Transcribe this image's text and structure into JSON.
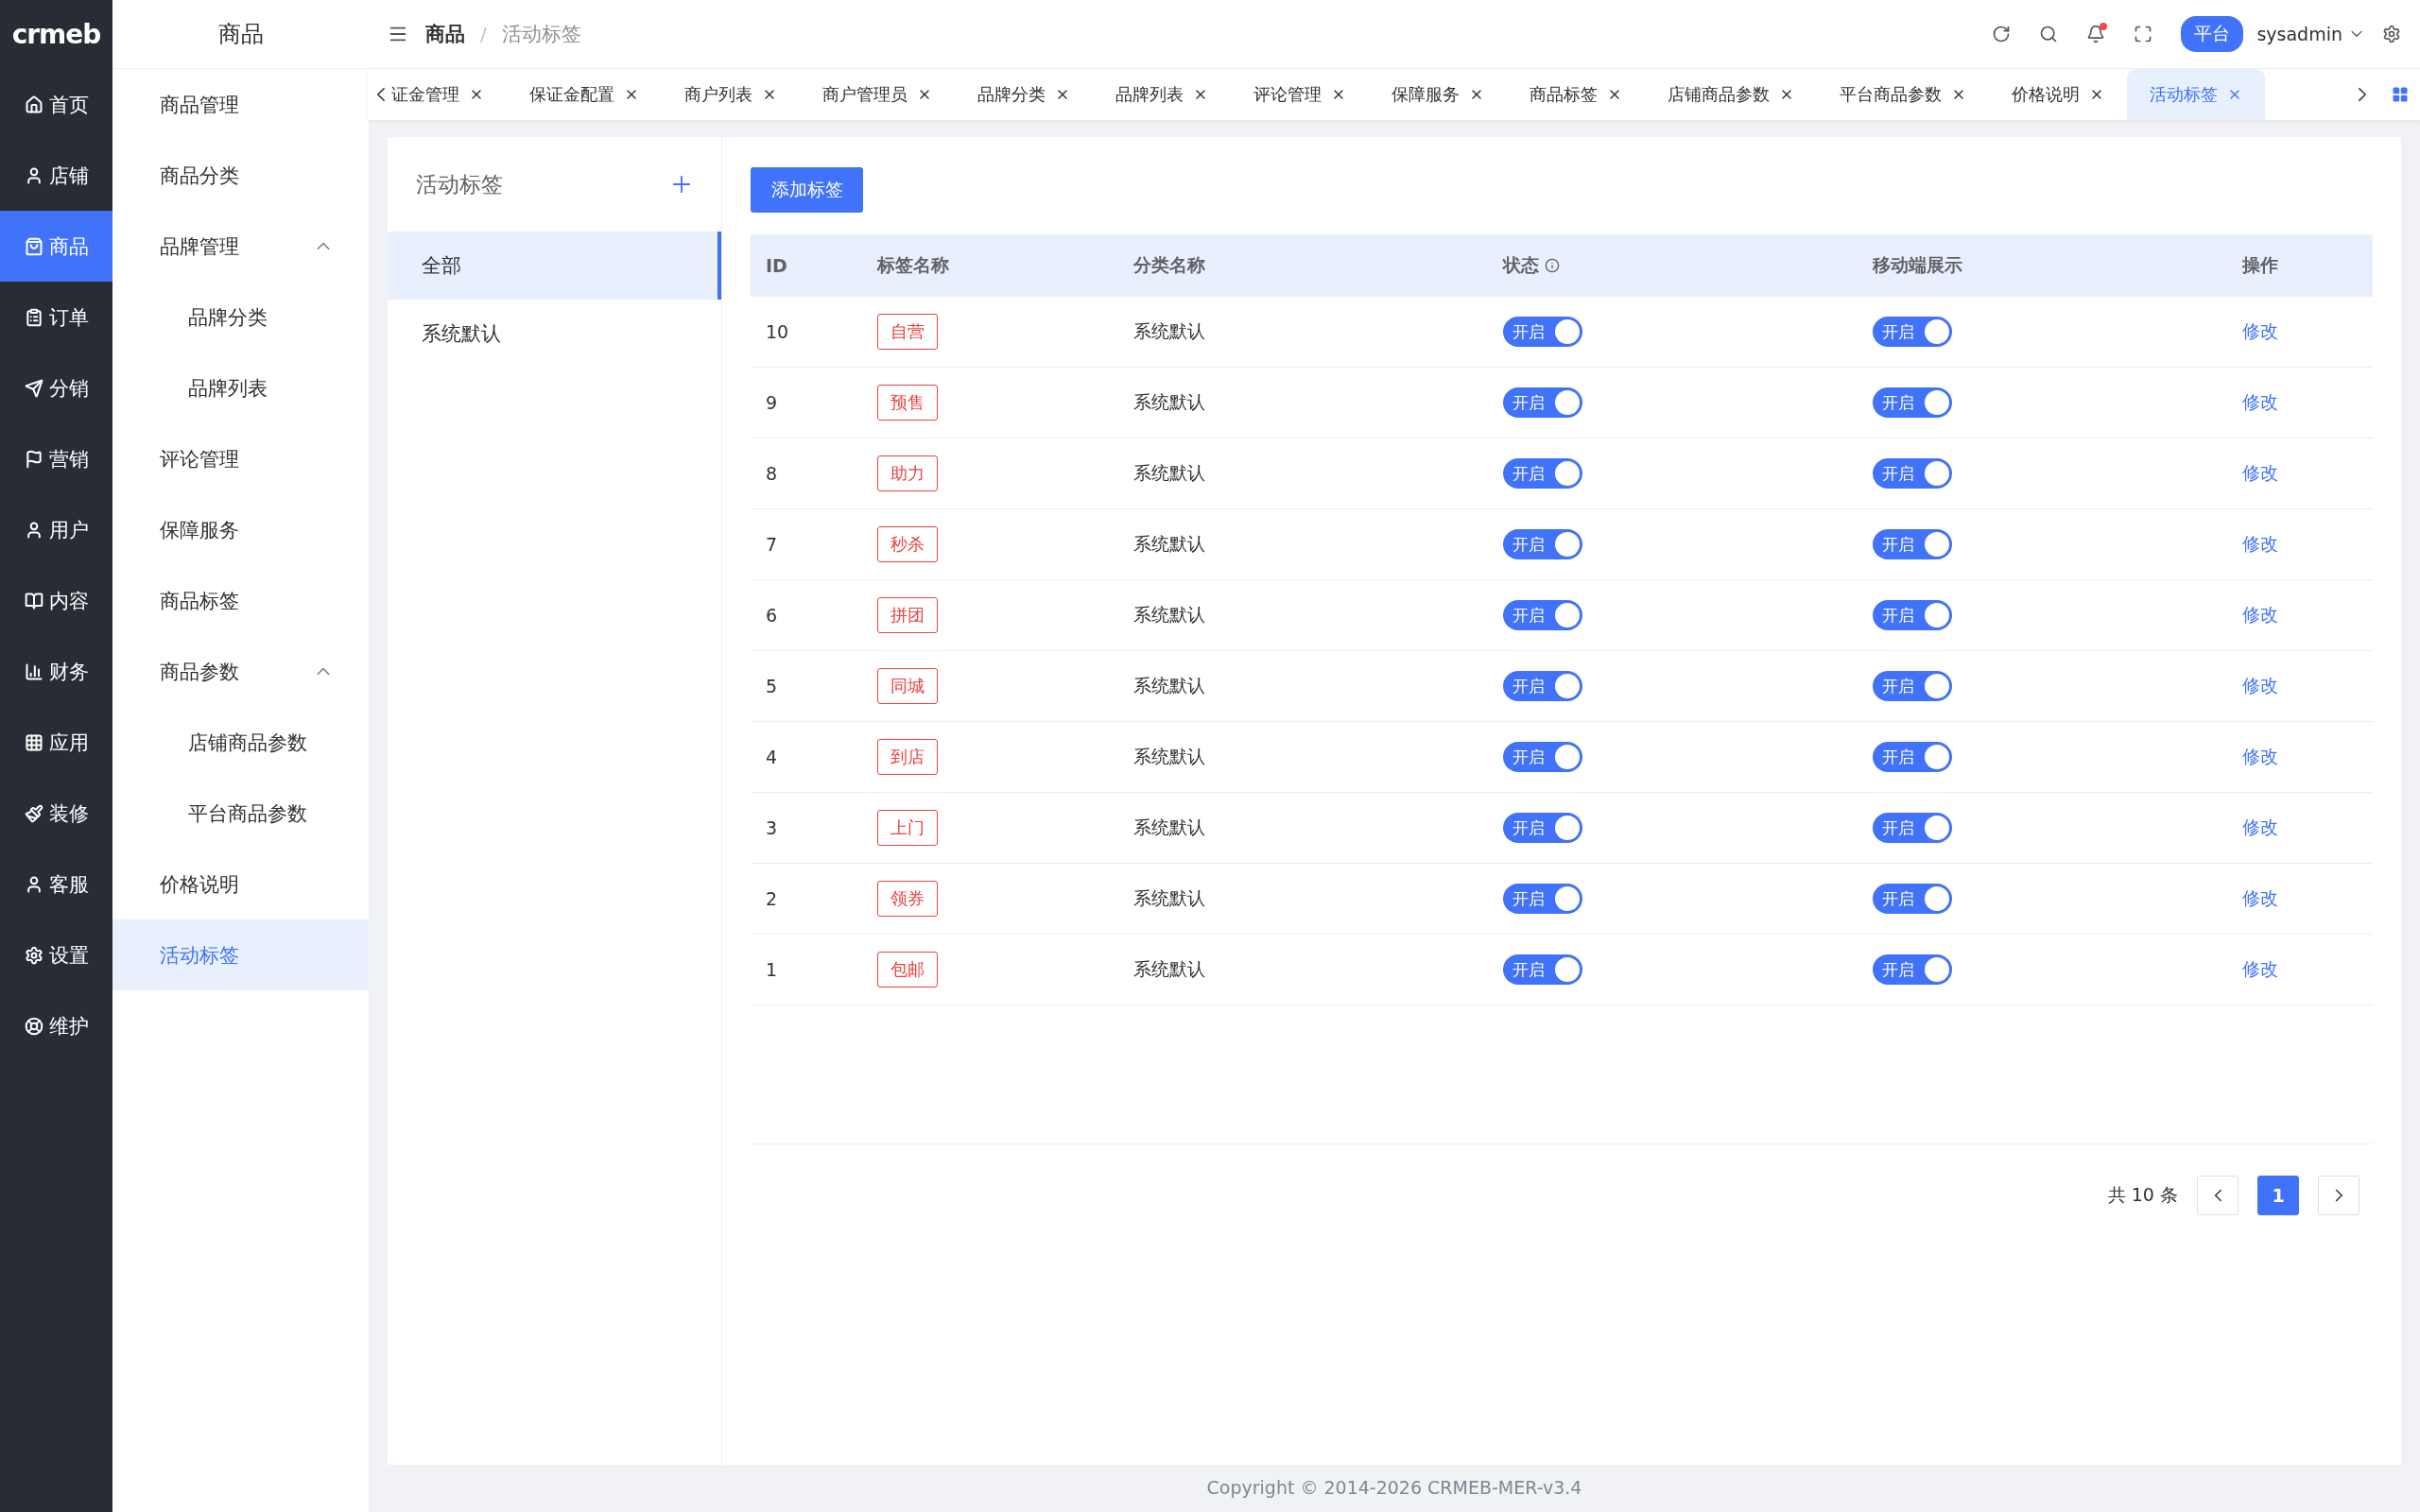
{
  "logo": "crmeb",
  "main_nav": [
    {
      "label": "首页",
      "selected": false
    },
    {
      "label": "店铺",
      "selected": false
    },
    {
      "label": "商品",
      "selected": true
    },
    {
      "label": "订单",
      "selected": false
    },
    {
      "label": "分销",
      "selected": false
    },
    {
      "label": "营销",
      "selected": false
    },
    {
      "label": "用户",
      "selected": false
    },
    {
      "label": "内容",
      "selected": false
    },
    {
      "label": "财务",
      "selected": false
    },
    {
      "label": "应用",
      "selected": false
    },
    {
      "label": "装修",
      "selected": false
    },
    {
      "label": "客服",
      "selected": false
    },
    {
      "label": "设置",
      "selected": false
    },
    {
      "label": "维护",
      "selected": false
    }
  ],
  "sub_nav": {
    "title": "商品",
    "items": [
      {
        "label": "商品管理",
        "selected": false
      },
      {
        "label": "商品分类",
        "selected": false
      },
      {
        "label": "品牌管理",
        "selected": false,
        "expanded": true,
        "children": [
          {
            "label": "品牌分类",
            "selected": false
          },
          {
            "label": "品牌列表",
            "selected": false
          }
        ]
      },
      {
        "label": "评论管理",
        "selected": false
      },
      {
        "label": "保障服务",
        "selected": false
      },
      {
        "label": "商品标签",
        "selected": false
      },
      {
        "label": "商品参数",
        "selected": false,
        "expanded": true,
        "children": [
          {
            "label": "店铺商品参数",
            "selected": false
          },
          {
            "label": "平台商品参数",
            "selected": false
          }
        ]
      },
      {
        "label": "价格说明",
        "selected": false
      },
      {
        "label": "活动标签",
        "selected": true
      }
    ]
  },
  "breadcrumb": {
    "items": [
      "商品",
      "活动标签"
    ],
    "separator": "/"
  },
  "header": {
    "role_badge": "平台",
    "user": "sysadmin",
    "notification_dot": true
  },
  "tabs": [
    {
      "label": "证金管理",
      "selected": false
    },
    {
      "label": "保证金配置",
      "selected": false
    },
    {
      "label": "商户列表",
      "selected": false
    },
    {
      "label": "商户管理员",
      "selected": false
    },
    {
      "label": "品牌分类",
      "selected": false
    },
    {
      "label": "品牌列表",
      "selected": false
    },
    {
      "label": "评论管理",
      "selected": false
    },
    {
      "label": "保障服务",
      "selected": false
    },
    {
      "label": "商品标签",
      "selected": false
    },
    {
      "label": "店铺商品参数",
      "selected": false
    },
    {
      "label": "平台商品参数",
      "selected": false
    },
    {
      "label": "价格说明",
      "selected": false
    },
    {
      "label": "活动标签",
      "selected": true
    }
  ],
  "category_panel": {
    "title": "活动标签",
    "items": [
      {
        "label": "全部",
        "selected": true
      },
      {
        "label": "系统默认",
        "selected": false
      }
    ]
  },
  "add_button": "添加标签",
  "table": {
    "columns": [
      "ID",
      "标签名称",
      "分类名称",
      "状态",
      "移动端展示",
      "操作"
    ],
    "rows": [
      {
        "id": "10",
        "tag": "自营",
        "category": "系统默认",
        "status_on": true,
        "status_label": "开启",
        "mobile_on": true,
        "mobile_label": "开启",
        "action": "修改"
      },
      {
        "id": "9",
        "tag": "预售",
        "category": "系统默认",
        "status_on": true,
        "status_label": "开启",
        "mobile_on": true,
        "mobile_label": "开启",
        "action": "修改"
      },
      {
        "id": "8",
        "tag": "助力",
        "category": "系统默认",
        "status_on": true,
        "status_label": "开启",
        "mobile_on": true,
        "mobile_label": "开启",
        "action": "修改"
      },
      {
        "id": "7",
        "tag": "秒杀",
        "category": "系统默认",
        "status_on": true,
        "status_label": "开启",
        "mobile_on": true,
        "mobile_label": "开启",
        "action": "修改"
      },
      {
        "id": "6",
        "tag": "拼团",
        "category": "系统默认",
        "status_on": true,
        "status_label": "开启",
        "mobile_on": true,
        "mobile_label": "开启",
        "action": "修改"
      },
      {
        "id": "5",
        "tag": "同城",
        "category": "系统默认",
        "status_on": true,
        "status_label": "开启",
        "mobile_on": true,
        "mobile_label": "开启",
        "action": "修改"
      },
      {
        "id": "4",
        "tag": "到店",
        "category": "系统默认",
        "status_on": true,
        "status_label": "开启",
        "mobile_on": true,
        "mobile_label": "开启",
        "action": "修改"
      },
      {
        "id": "3",
        "tag": "上门",
        "category": "系统默认",
        "status_on": true,
        "status_label": "开启",
        "mobile_on": true,
        "mobile_label": "开启",
        "action": "修改"
      },
      {
        "id": "2",
        "tag": "领券",
        "category": "系统默认",
        "status_on": true,
        "status_label": "开启",
        "mobile_on": true,
        "mobile_label": "开启",
        "action": "修改"
      },
      {
        "id": "1",
        "tag": "包邮",
        "category": "系统默认",
        "status_on": true,
        "status_label": "开启",
        "mobile_on": true,
        "mobile_label": "开启",
        "action": "修改"
      }
    ]
  },
  "pagination": {
    "total": "共 10 条",
    "pages": [
      {
        "label": "1",
        "selected": true
      }
    ]
  },
  "footer": "Copyright © 2014-2026 CRMEB-MER-v3.4"
}
